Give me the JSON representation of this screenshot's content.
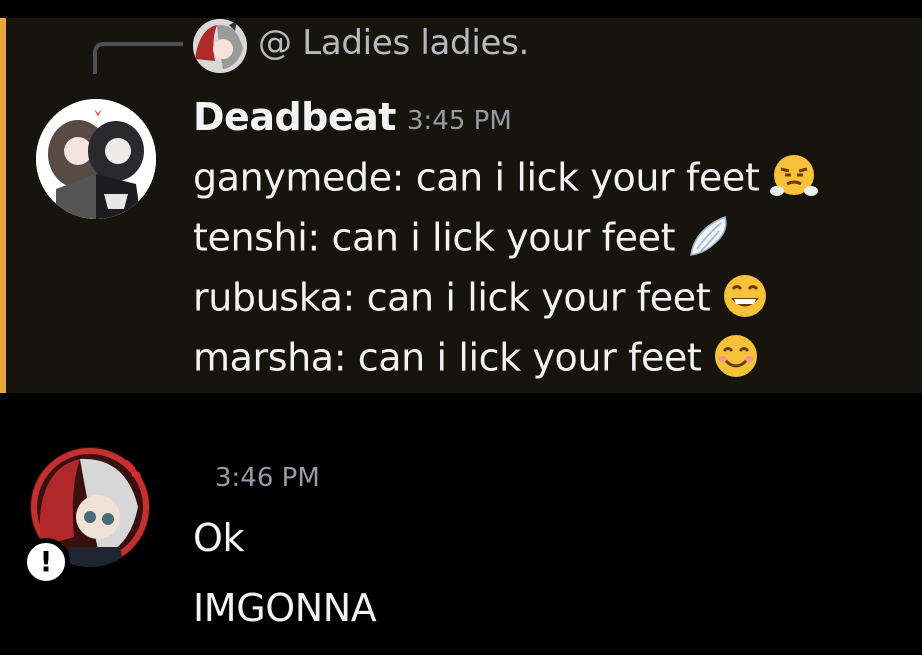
{
  "reply": {
    "mention_prefix": "@",
    "text": "Ladies ladies."
  },
  "message1": {
    "username": "Deadbeat",
    "timestamp": "3:45 PM",
    "lines": [
      {
        "text": "ganymede: can i lick your feet",
        "emoji": "steam-face-emoji"
      },
      {
        "text": "tenshi: can i lick your feet",
        "emoji": "wing-emoji"
      },
      {
        "text": "rubuska: can i lick your feet",
        "emoji": "grinning-face-emoji"
      },
      {
        "text": "marsha: can i lick your feet",
        "emoji": "smiling-face-emoji"
      }
    ]
  },
  "message2": {
    "timestamp": "3:46 PM",
    "lines": [
      "Ok",
      "IMGONNA"
    ],
    "status_badge": "!"
  },
  "colors": {
    "highlight_bg": "#17140d",
    "highlight_bar": "#e8a93b",
    "muted_text": "#949ba4",
    "text": "#f2f3f5"
  }
}
